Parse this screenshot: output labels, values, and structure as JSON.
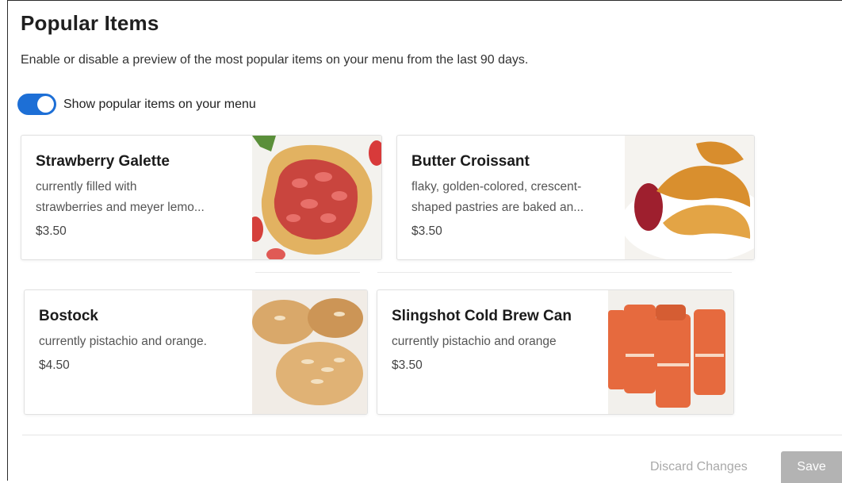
{
  "header": {
    "title": "Popular Items",
    "description": "Enable or disable a preview of the most popular items on your menu from the last 90 days."
  },
  "toggle": {
    "label": "Show popular items on your menu",
    "on": true,
    "color": "#1d6fd6"
  },
  "items": [
    {
      "name": "Strawberry Galette",
      "description_line1": "currently filled with",
      "description_line2": "strawberries and meyer lemo...",
      "price": "$3.50",
      "image": "strawberry-galette-photo"
    },
    {
      "name": "Butter Croissant",
      "description_line1": "flaky, golden-colored, crescent-",
      "description_line2": "shaped pastries are baked an...",
      "price": "$3.50",
      "image": "butter-croissant-photo"
    },
    {
      "name": "Bostock",
      "description_line1": "currently pistachio and orange.",
      "description_line2": "",
      "price": "$4.50",
      "image": "bostock-photo"
    },
    {
      "name": "Slingshot Cold Brew Can",
      "description_line1": "currently pistachio and orange",
      "description_line2": "",
      "price": "$3.50",
      "image": "slingshot-cans-photo"
    }
  ],
  "footer": {
    "discard_label": "Discard Changes",
    "save_label": "Save"
  }
}
